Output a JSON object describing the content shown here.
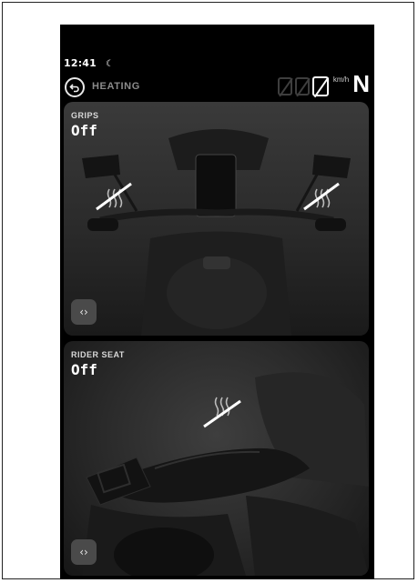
{
  "status_bar": {
    "time": "12:41",
    "night_icon": "moon-icon"
  },
  "header": {
    "title": "HEATING",
    "back_icon": "back-arrow-icon"
  },
  "speedometer": {
    "speed_value": "0",
    "unit": "km/h",
    "gear": "N"
  },
  "grips_card": {
    "label": "GRIPS",
    "value": "Off",
    "heat_icon": "heated-grip-icon",
    "expand_icon": "expand-arrows-icon",
    "expand_glyph": "‹›"
  },
  "seat_card": {
    "label": "RIDER SEAT",
    "value": "Off",
    "heat_icon": "heated-seat-icon",
    "expand_icon": "expand-arrows-icon",
    "expand_glyph": "‹›"
  },
  "colors": {
    "background": "#000000",
    "card": "#2e2e2e",
    "text": "#ffffff",
    "muted": "#8b8b8b"
  }
}
